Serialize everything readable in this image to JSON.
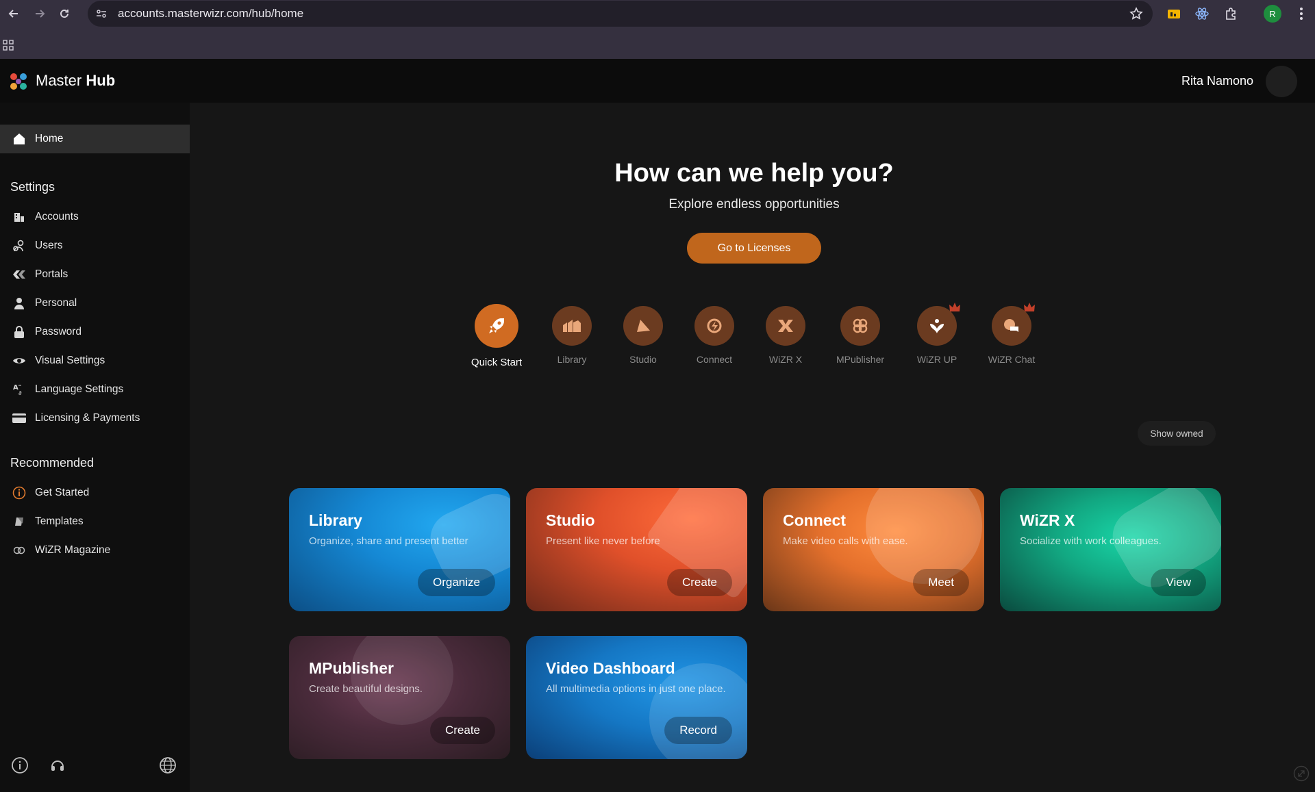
{
  "browser": {
    "url": "accounts.masterwizr.com/hub/home",
    "profile_initial": "R"
  },
  "header": {
    "brand_light": "Master",
    "brand_bold": "Hub",
    "user_name": "Rita Namono"
  },
  "sidebar": {
    "home": "Home",
    "settings_heading": "Settings",
    "settings_items": [
      {
        "label": "Accounts",
        "icon": "building-icon"
      },
      {
        "label": "Users",
        "icon": "users-icon"
      },
      {
        "label": "Portals",
        "icon": "portals-icon"
      },
      {
        "label": "Personal",
        "icon": "person-icon"
      },
      {
        "label": "Password",
        "icon": "lock-icon"
      },
      {
        "label": "Visual Settings",
        "icon": "eye-icon"
      },
      {
        "label": "Language Settings",
        "icon": "translate-icon"
      },
      {
        "label": "Licensing & Payments",
        "icon": "card-icon"
      }
    ],
    "recommended_heading": "Recommended",
    "recommended_items": [
      {
        "label": "Get Started",
        "icon": "info-icon"
      },
      {
        "label": "Templates",
        "icon": "templates-icon"
      },
      {
        "label": "WiZR Magazine",
        "icon": "magazine-icon"
      }
    ]
  },
  "hero": {
    "title": "How can we help you?",
    "subtitle": "Explore endless opportunities",
    "button": "Go to Licenses"
  },
  "apps": [
    {
      "name": "Quick Start",
      "icon": "rocket-icon"
    },
    {
      "name": "Library",
      "icon": "library-icon"
    },
    {
      "name": "Studio",
      "icon": "studio-icon"
    },
    {
      "name": "Connect",
      "icon": "connect-icon"
    },
    {
      "name": "WiZR X",
      "icon": "wizrx-icon"
    },
    {
      "name": "MPublisher",
      "icon": "mpublisher-icon"
    },
    {
      "name": "WiZR UP",
      "icon": "wizrup-icon"
    },
    {
      "name": "WiZR Chat",
      "icon": "chat-icon"
    }
  ],
  "show_owned": "Show owned",
  "cards": [
    {
      "title": "Library",
      "desc": "Organize, share and present better",
      "button": "Organize"
    },
    {
      "title": "Studio",
      "desc": "Present like never before",
      "button": "Create"
    },
    {
      "title": "Connect",
      "desc": "Make video calls with ease.",
      "button": "Meet"
    },
    {
      "title": "WiZR X",
      "desc": "Socialize with work colleagues.",
      "button": "View"
    },
    {
      "title": "MPublisher",
      "desc": "Create beautiful designs.",
      "button": "Create"
    },
    {
      "title": "Video Dashboard",
      "desc": "All multimedia options in just one place.",
      "button": "Record"
    }
  ],
  "colors": {
    "accent": "#c0661c",
    "app_icon_bg": "#6b3b20",
    "card_library": "#1d8fd9",
    "card_studio": "#e2542a",
    "card_connect": "#e6782e",
    "card_wizrx": "#12b890",
    "card_mpublisher": "#5a3347",
    "card_video": "#1a7fd0"
  }
}
